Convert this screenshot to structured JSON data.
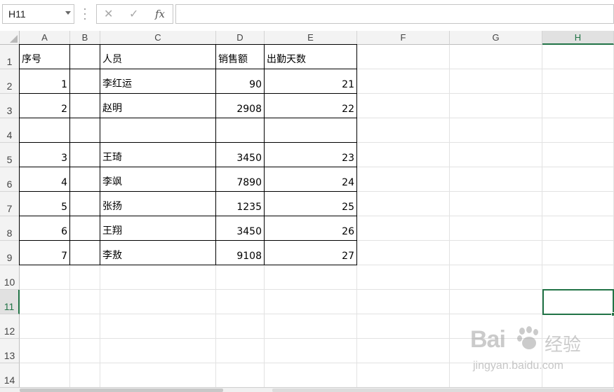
{
  "formula_bar": {
    "name_box": "H11",
    "cancel_glyph": "✕",
    "enter_glyph": "✓",
    "fx_glyph": "fx",
    "formula": ""
  },
  "columns": [
    "A",
    "B",
    "C",
    "D",
    "E",
    "F",
    "G",
    "H"
  ],
  "selected_column": "H",
  "rows": [
    "1",
    "2",
    "3",
    "4",
    "5",
    "6",
    "7",
    "8",
    "9",
    "10",
    "11",
    "12",
    "13",
    "14"
  ],
  "selected_row": "11",
  "table": {
    "headers": [
      "序号",
      "",
      "人员",
      "销售额",
      "出勤天数"
    ],
    "records": [
      {
        "seq": "1",
        "name": "李红运",
        "sales": "90",
        "days": "21"
      },
      {
        "seq": "2",
        "name": "赵明",
        "sales": "2908",
        "days": "22"
      },
      {
        "seq": "",
        "name": "",
        "sales": "",
        "days": ""
      },
      {
        "seq": "3",
        "name": "王琦",
        "sales": "3450",
        "days": "23"
      },
      {
        "seq": "4",
        "name": "李飒",
        "sales": "7890",
        "days": "24"
      },
      {
        "seq": "5",
        "name": "张扬",
        "sales": "1235",
        "days": "25"
      },
      {
        "seq": "6",
        "name": "王翔",
        "sales": "3450",
        "days": "26"
      },
      {
        "seq": "7",
        "name": "李敖",
        "sales": "9108",
        "days": "27"
      }
    ]
  },
  "watermark": {
    "logo": "Bai",
    "logo_suffix": "经验",
    "url": "jingyan.baidu.com"
  },
  "colors": {
    "accent": "#217346",
    "header_bg": "#f3f3f3",
    "gridline": "#e2e2e2"
  }
}
